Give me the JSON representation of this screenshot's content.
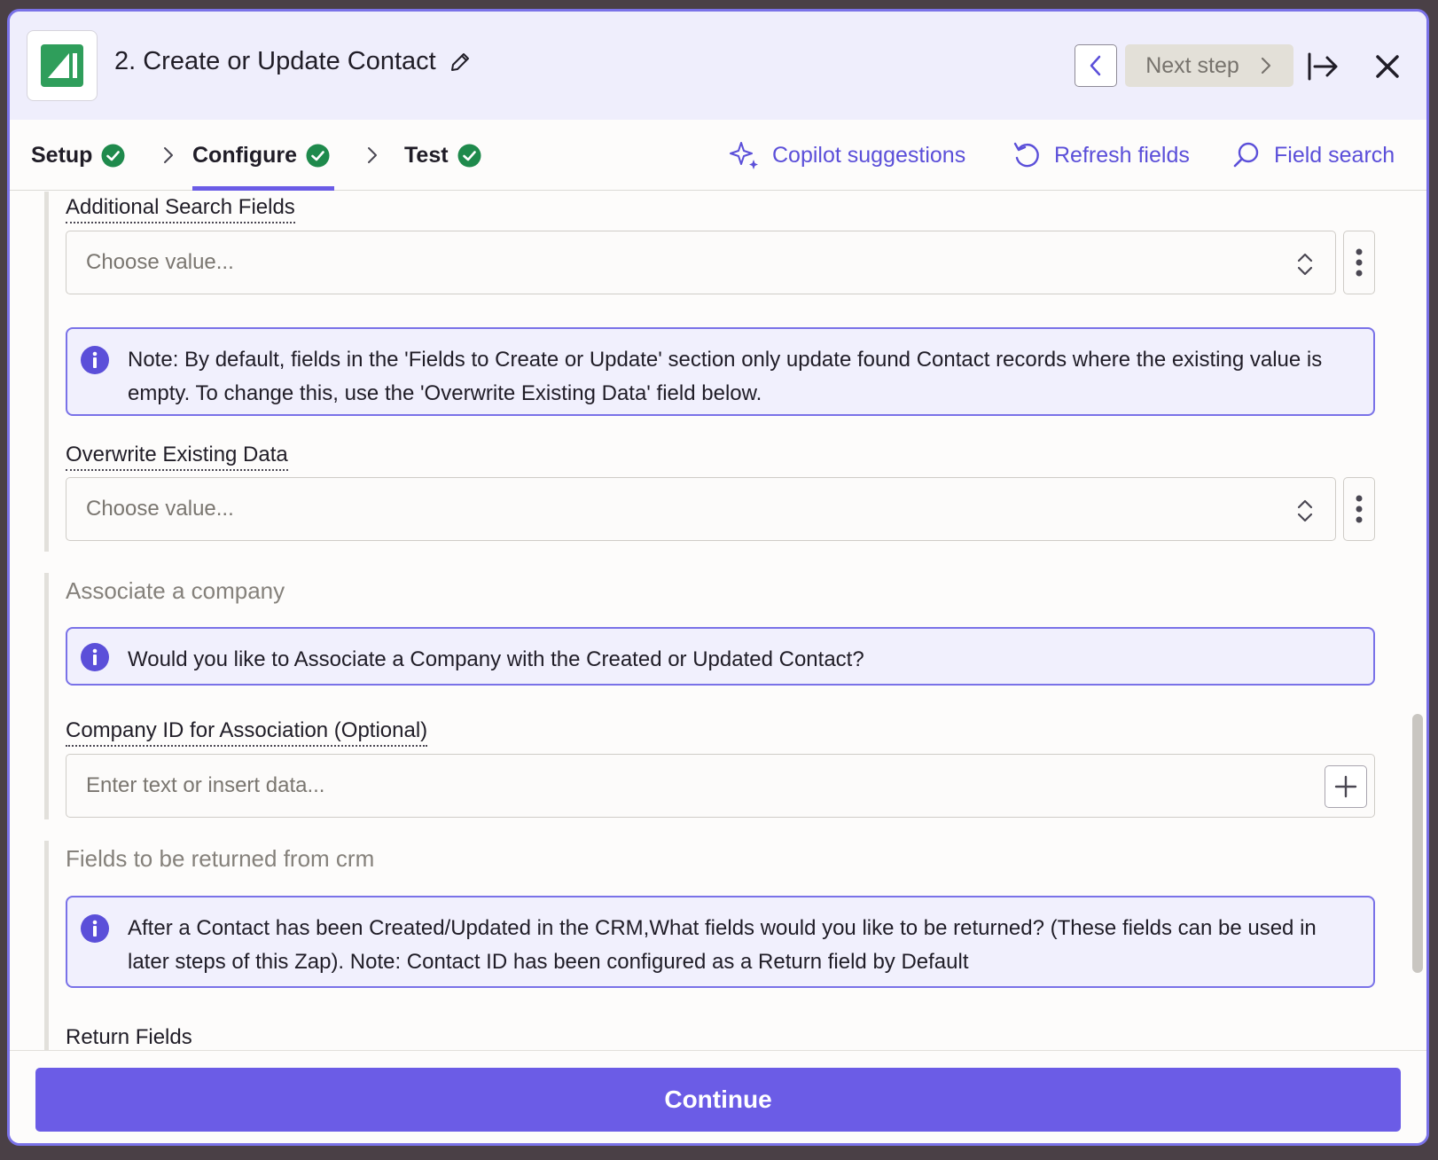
{
  "header": {
    "title": "2. Create or Update Contact",
    "next_step_label": "Next step",
    "logo_icon": "app-logo-icon",
    "accent": "#6b5ce6"
  },
  "tabs": [
    {
      "label": "Setup",
      "complete": true
    },
    {
      "label": "Configure",
      "complete": true,
      "active": true
    },
    {
      "label": "Test",
      "complete": true
    }
  ],
  "toolbar": {
    "copilot_label": "Copilot suggestions",
    "refresh_label": "Refresh fields",
    "search_label": "Field search"
  },
  "fields": {
    "additional_search": {
      "label": "Additional Search Fields",
      "placeholder": "Choose value..."
    },
    "overwrite_note": "Note: By default, fields in the 'Fields to Create or Update' section only update found Contact records where the existing value is empty. To change this, use the 'Overwrite Existing Data' field below.",
    "overwrite": {
      "label": "Overwrite Existing Data",
      "placeholder": "Choose value..."
    }
  },
  "associate": {
    "title": "Associate a company",
    "note": "Would you like to Associate a Company with the Created or Updated Contact?",
    "company_id": {
      "label": "Company ID for Association (Optional)",
      "placeholder": "Enter text or insert data..."
    }
  },
  "returned": {
    "title": "Fields to be returned from crm",
    "note": "After a Contact has been Created/Updated in the CRM,What fields would you like to be returned? (These fields can be used in later steps of this Zap). Note: Contact ID has been configured as a Return field by Default",
    "return_fields_label": "Return Fields"
  },
  "footer": {
    "continue_label": "Continue"
  }
}
